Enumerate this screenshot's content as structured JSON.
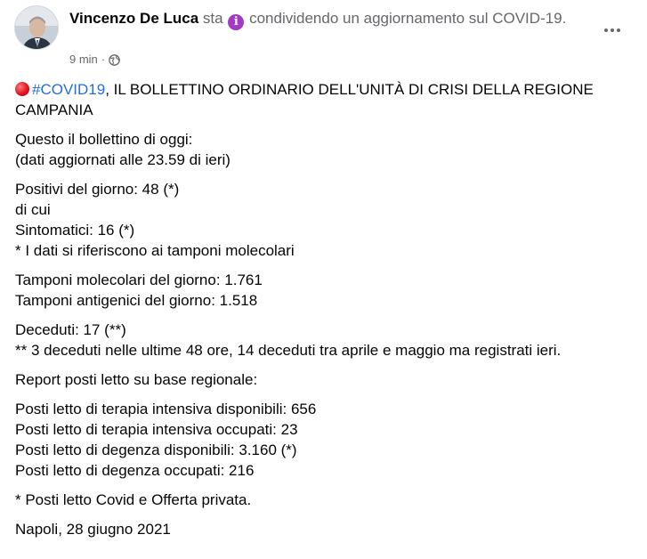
{
  "post": {
    "author": "Vincenzo De Luca",
    "action_prefix": "sta",
    "action_icon": "info-icon",
    "action_text": "condividendo un aggiornamento sul COVID-19.",
    "time": "9 min",
    "time_separator": "·",
    "audience_icon": "globe-icon",
    "more_icon": "more-options-icon"
  },
  "content": {
    "headline_emoji": "red-circle-icon",
    "hashtag": "#COVID19",
    "headline": ", IL BOLLETTINO ORDINARIO DELL'UNITÀ DI CRISI DELLA REGIONE CAMPANIA",
    "intro": [
      "Questo il bollettino di oggi:",
      "(dati aggiornati alle 23.59 di ieri)"
    ],
    "positivi": [
      "Positivi del giorno: 48 (*)",
      "di cui",
      "Sintomatici: 16 (*)",
      "* I dati si riferiscono ai tamponi molecolari"
    ],
    "tamponi": [
      "Tamponi molecolari del giorno: 1.761",
      "Tamponi antigenici del giorno: 1.518"
    ],
    "deceduti": [
      "Deceduti: 17 (**)",
      "** 3 deceduti nelle ultime 48 ore, 14 deceduti tra aprile e maggio ma registrati ieri."
    ],
    "report_title": "Report posti letto su base regionale:",
    "posti_letto": [
      "Posti letto di terapia intensiva disponibili: 656",
      "Posti letto di terapia intensiva occupati: 23",
      "Posti letto di degenza disponibili: 3.160 (*)",
      "Posti letto di degenza occupati: 216"
    ],
    "footnote": "* Posti letto Covid e Offerta privata.",
    "signature": "Napoli, 28 giugno 2021"
  },
  "colors": {
    "hashtag": "#216fdb",
    "secondary_text": "#65676b",
    "primary_text": "#050505",
    "info_icon": "#a33bc2"
  }
}
